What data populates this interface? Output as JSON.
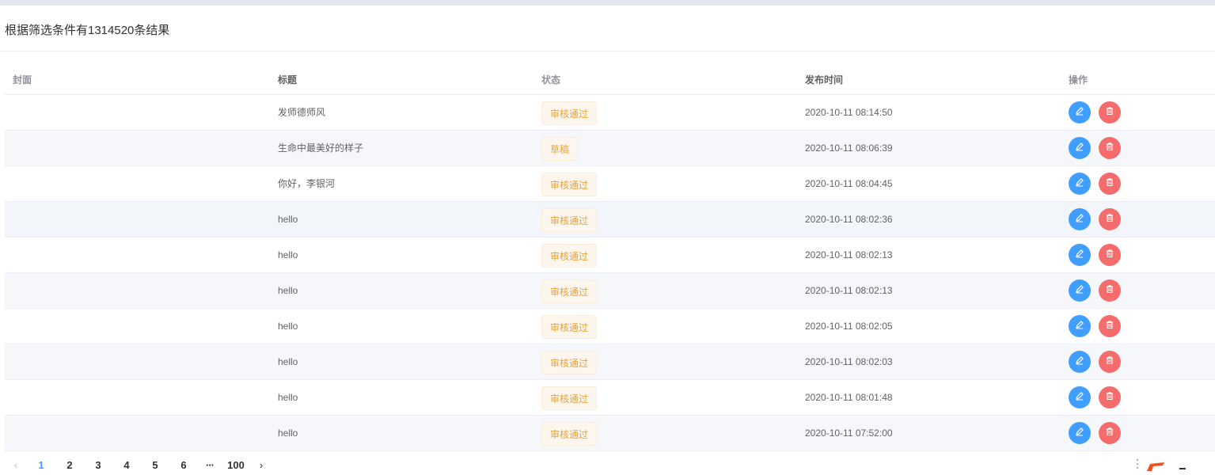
{
  "header": {
    "results_text": "根据筛选条件有1314520条结果"
  },
  "table": {
    "columns": [
      "封面",
      "标题",
      "状态",
      "发布时间",
      "操作"
    ],
    "rows": [
      {
        "cover": "",
        "title": "发师德师风",
        "status": "审核通过",
        "time": "2020-10-11 08:14:50"
      },
      {
        "cover": "",
        "title": "生命中最美好的样子",
        "status": "草稿",
        "time": "2020-10-11 08:06:39"
      },
      {
        "cover": "",
        "title": "你好，李银河",
        "status": "审核通过",
        "time": "2020-10-11 08:04:45"
      },
      {
        "cover": "",
        "title": "hello",
        "status": "审核通过",
        "time": "2020-10-11 08:02:36"
      },
      {
        "cover": "",
        "title": "hello",
        "status": "审核通过",
        "time": "2020-10-11 08:02:13"
      },
      {
        "cover": "",
        "title": "hello",
        "status": "审核通过",
        "time": "2020-10-11 08:02:13"
      },
      {
        "cover": "",
        "title": "hello",
        "status": "审核通过",
        "time": "2020-10-11 08:02:05"
      },
      {
        "cover": "",
        "title": "hello",
        "status": "审核通过",
        "time": "2020-10-11 08:02:03"
      },
      {
        "cover": "",
        "title": "hello",
        "status": "审核通过",
        "time": "2020-10-11 08:01:48"
      },
      {
        "cover": "",
        "title": "hello",
        "status": "审核通过",
        "time": "2020-10-11 07:52:00"
      }
    ],
    "actions": {
      "edit_icon": "edit-icon",
      "delete_icon": "trash-icon"
    }
  },
  "pagination": {
    "prev": "‹",
    "pages": [
      "1",
      "2",
      "3",
      "4",
      "5",
      "6"
    ],
    "ellipsis": "···",
    "last": "100",
    "next": "›",
    "current": "1"
  },
  "colors": {
    "primary": "#409eff",
    "danger": "#f56c6c",
    "warning_text": "#e6a23c",
    "warning_bg": "#fdf6ec",
    "stripe_bg": "#f5f7fa"
  }
}
